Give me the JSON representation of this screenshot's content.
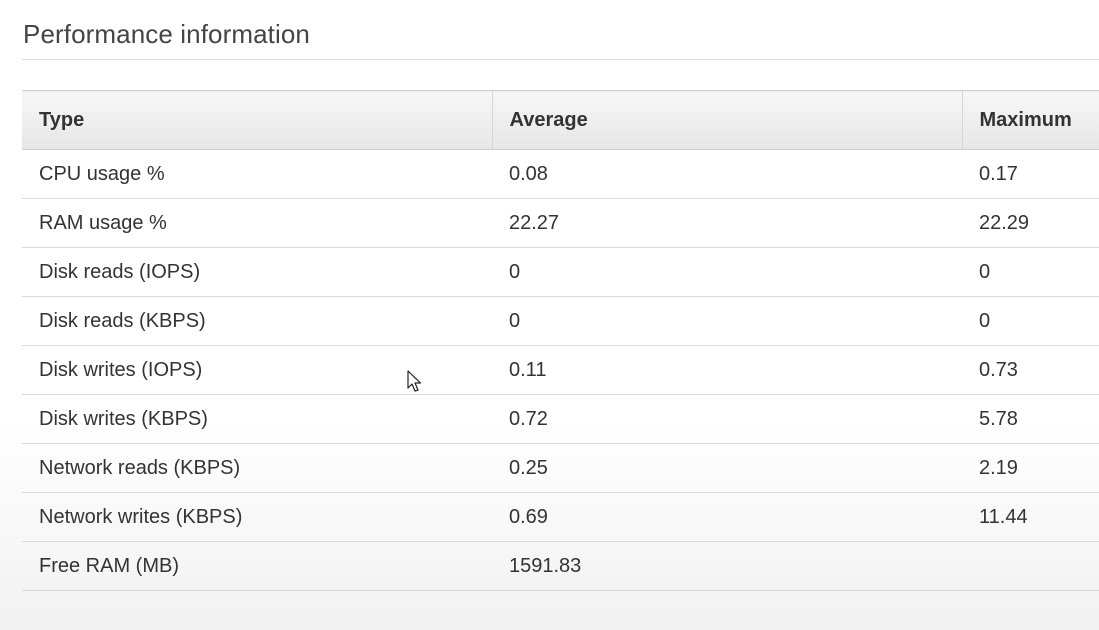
{
  "page_title": "Performance information",
  "table": {
    "headers": [
      "Type",
      "Average",
      "Maximum"
    ],
    "rows": [
      {
        "type": "CPU usage %",
        "average": "0.08",
        "maximum": "0.17"
      },
      {
        "type": "RAM usage %",
        "average": "22.27",
        "maximum": "22.29"
      },
      {
        "type": "Disk reads (IOPS)",
        "average": "0",
        "maximum": "0"
      },
      {
        "type": "Disk reads (KBPS)",
        "average": "0",
        "maximum": "0"
      },
      {
        "type": "Disk writes (IOPS)",
        "average": "0.11",
        "maximum": "0.73"
      },
      {
        "type": "Disk writes (KBPS)",
        "average": "0.72",
        "maximum": "5.78"
      },
      {
        "type": "Network reads (KBPS)",
        "average": "0.25",
        "maximum": "2.19"
      },
      {
        "type": "Network writes (KBPS)",
        "average": "0.69",
        "maximum": "11.44"
      },
      {
        "type": "Free RAM (MB)",
        "average": "1591.83",
        "maximum": ""
      }
    ]
  },
  "icons": {
    "cursor": "mouse-pointer-icon"
  }
}
